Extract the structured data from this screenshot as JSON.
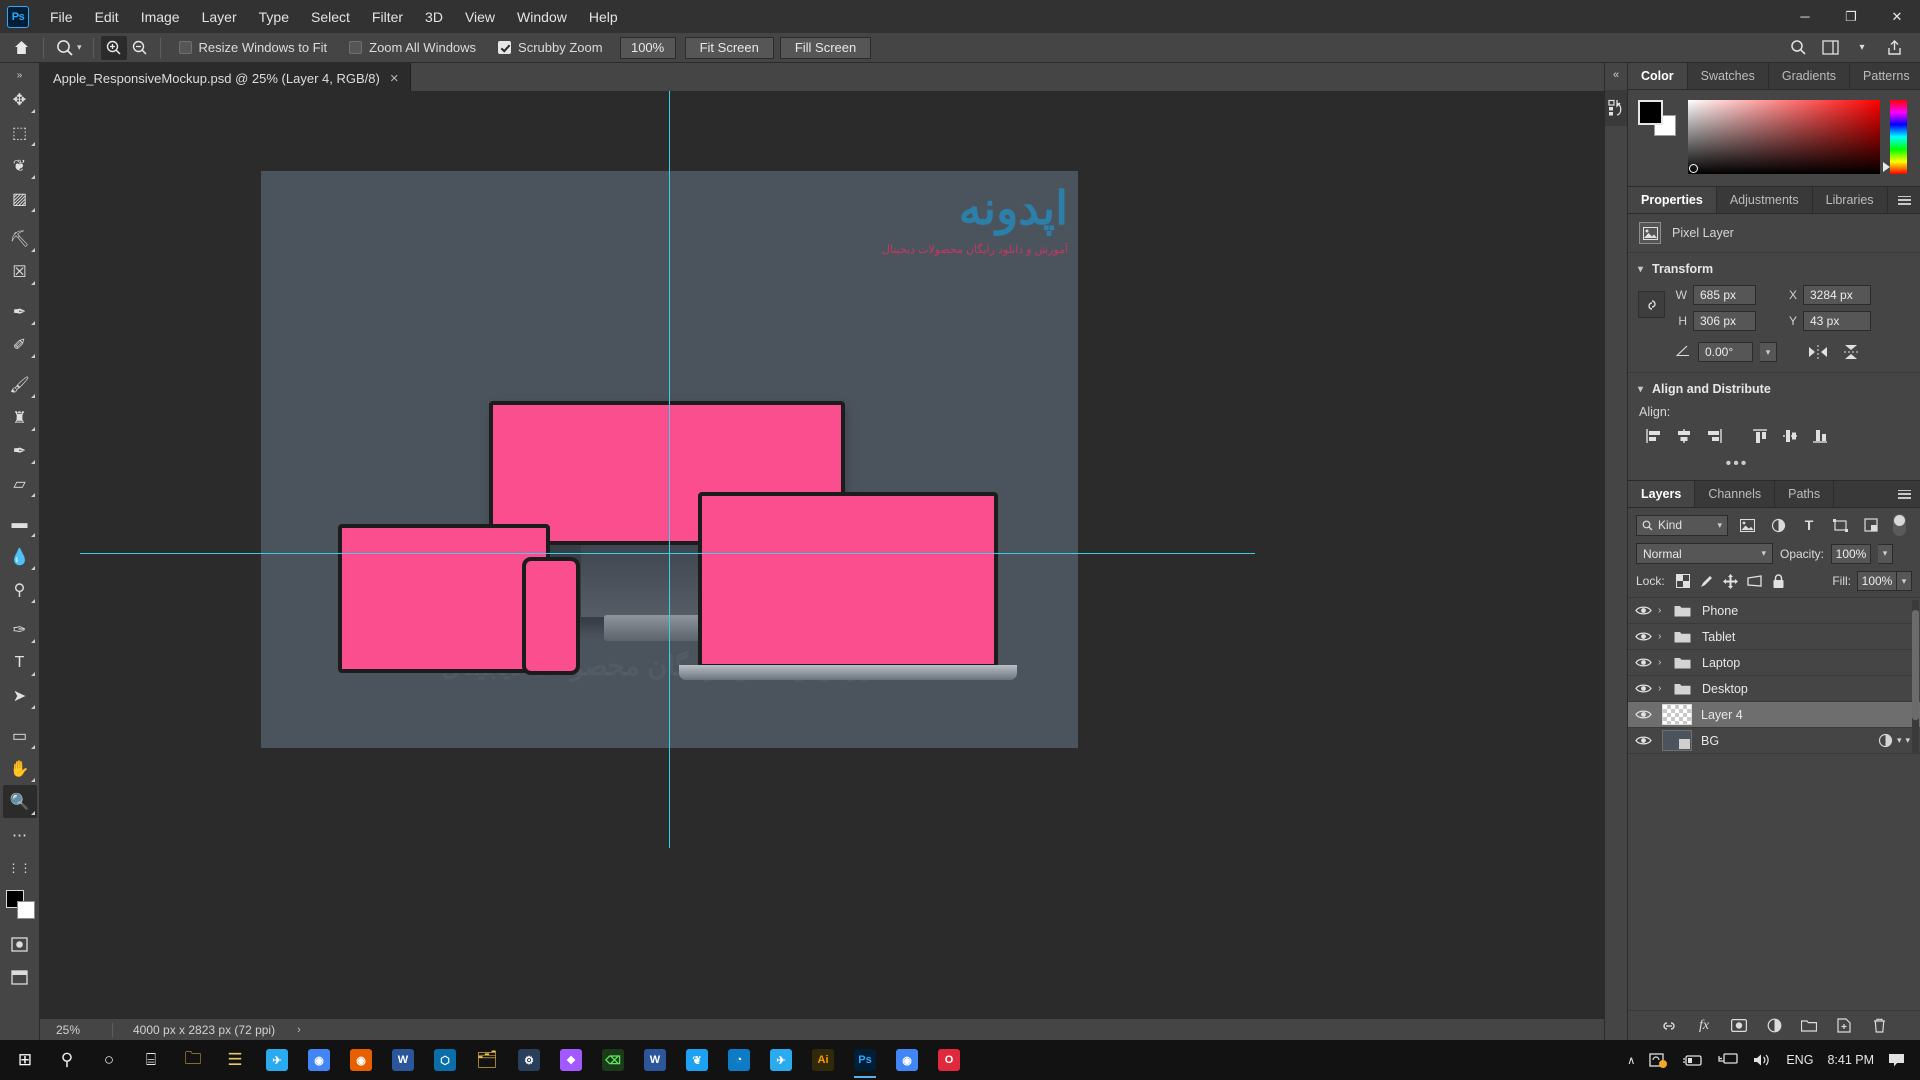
{
  "app": {
    "name": "Adobe Photoshop",
    "logo_text": "Ps"
  },
  "menubar": {
    "items": [
      "File",
      "Edit",
      "Image",
      "Layer",
      "Type",
      "Select",
      "Filter",
      "3D",
      "View",
      "Window",
      "Help"
    ]
  },
  "window_controls": {
    "minimize": "─",
    "maximize": "❐",
    "close": "✕"
  },
  "options_bar": {
    "home_icon": "home-icon",
    "tool_icon": "zoom-tool-icon",
    "zoom_in_label": "zoom-in-icon",
    "zoom_out_label": "zoom-out-icon",
    "checkboxes": [
      {
        "label": "Resize Windows to Fit",
        "checked": false
      },
      {
        "label": "Zoom All Windows",
        "checked": false
      },
      {
        "label": "Scrubby Zoom",
        "checked": true
      }
    ],
    "zoom_value": "100%",
    "buttons": [
      "Fit Screen",
      "Fill Screen"
    ],
    "right_icons": [
      "search-icon",
      "workspace-icon",
      "chevron-down-icon",
      "share-icon"
    ]
  },
  "toolbar": {
    "tools": [
      {
        "name": "move-tool",
        "glyph": "✥"
      },
      {
        "name": "rectangular-marquee-tool",
        "glyph": "⬚"
      },
      {
        "name": "lasso-tool",
        "glyph": "❦"
      },
      {
        "name": "object-selection-tool",
        "glyph": "▨"
      },
      {
        "name": "crop-tool",
        "glyph": "⛏"
      },
      {
        "name": "frame-tool",
        "glyph": "☒"
      },
      {
        "name": "eyedropper-tool",
        "glyph": "✒"
      },
      {
        "name": "spot-healing-brush-tool",
        "glyph": "✐"
      },
      {
        "name": "brush-tool",
        "glyph": "🖌"
      },
      {
        "name": "clone-stamp-tool",
        "glyph": "♜"
      },
      {
        "name": "history-brush-tool",
        "glyph": "✒"
      },
      {
        "name": "eraser-tool",
        "glyph": "▱"
      },
      {
        "name": "gradient-tool",
        "glyph": "▬"
      },
      {
        "name": "blur-tool",
        "glyph": "💧"
      },
      {
        "name": "dodge-tool",
        "glyph": "⚲"
      },
      {
        "name": "pen-tool",
        "glyph": "✑"
      },
      {
        "name": "type-tool",
        "glyph": "T"
      },
      {
        "name": "path-selection-tool",
        "glyph": "➤"
      },
      {
        "name": "rectangle-tool",
        "glyph": "▭"
      },
      {
        "name": "hand-tool",
        "glyph": "✋"
      },
      {
        "name": "zoom-tool",
        "glyph": "🔍",
        "active": true
      }
    ],
    "extra": [
      {
        "name": "more-tools-button",
        "glyph": "⋯"
      },
      {
        "name": "edit-toolbar-button",
        "glyph": "⋮⋮"
      },
      {
        "name": "quick-mask-button",
        "glyph": "▣"
      },
      {
        "name": "screen-mode-button",
        "glyph": "❐"
      }
    ],
    "foreground_color": "#000000",
    "background_color": "#ffffff"
  },
  "document": {
    "tab_title": "Apple_ResponsiveMockup.psd @ 25% (Layer 4, RGB/8)",
    "close_glyph": "×",
    "watermark_main": "اپدونه",
    "watermark_sub": "آموزش و دانلود رایگان محصولات دیجیتال",
    "watermark_faint": "آموزش و دانلود رایگان محصولات دیجیتال",
    "artboard_bg": "#4b535d",
    "device_screen_color": "#fb4e8f",
    "guide_color": "#35d1e8"
  },
  "status_bar": {
    "zoom": "25%",
    "doc_info": "4000 px x 2823 px (72 ppi)",
    "arrow": "›"
  },
  "rail": {
    "collapse_glyph": "«",
    "icon_name": "history-icon"
  },
  "color_panel": {
    "tabs": [
      "Color",
      "Swatches",
      "Gradients",
      "Patterns"
    ],
    "selected_tab": "Color",
    "foreground": "#000000",
    "background": "#ffffff",
    "menu_icon": "panel-menu-icon"
  },
  "properties_panel": {
    "tabs": [
      "Properties",
      "Adjustments",
      "Libraries"
    ],
    "selected_tab": "Properties",
    "layer_type": "Pixel Layer",
    "sections": {
      "transform": {
        "title": "Transform",
        "fields": [
          {
            "label": "W",
            "value": "685 px"
          },
          {
            "label": "X",
            "value": "3284 px"
          },
          {
            "label": "H",
            "value": "306 px"
          },
          {
            "label": "Y",
            "value": "43 px"
          }
        ],
        "angle_label": "angle-icon",
        "angle_value": "0.00°",
        "flip_horizontal": "flip-horizontal-icon",
        "flip_vertical": "flip-vertical-icon"
      },
      "align": {
        "title": "Align and Distribute",
        "label": "Align:",
        "buttons": [
          "align-left-edges-icon",
          "align-horizontal-centers-icon",
          "align-right-edges-icon",
          "align-top-edges-icon",
          "align-vertical-centers-icon",
          "align-bottom-edges-icon"
        ],
        "more": "•••"
      }
    }
  },
  "layers_panel": {
    "tabs": [
      "Layers",
      "Channels",
      "Paths"
    ],
    "selected_tab": "Layers",
    "filter": {
      "kind_label": "Kind",
      "search_icon": "search-icon",
      "type_icons": [
        "pixel-filter-icon",
        "adjustment-filter-icon",
        "type-filter-icon",
        "shape-filter-icon",
        "smartobject-filter-icon"
      ],
      "toggle_name": "filter-toggle"
    },
    "blend_mode": "Normal",
    "opacity_label": "Opacity:",
    "opacity_value": "100%",
    "lock_label": "Lock:",
    "lock_icons": [
      "lock-transparent-pixels-icon",
      "lock-image-pixels-icon",
      "lock-position-icon",
      "lock-artboard-icon",
      "lock-all-icon"
    ],
    "fill_label": "Fill:",
    "fill_value": "100%",
    "layers": [
      {
        "name": "Phone",
        "type": "group",
        "visible": true,
        "selected": false
      },
      {
        "name": "Tablet",
        "type": "group",
        "visible": true,
        "selected": false
      },
      {
        "name": "Laptop",
        "type": "group",
        "visible": true,
        "selected": false
      },
      {
        "name": "Desktop",
        "type": "group",
        "visible": true,
        "selected": false
      },
      {
        "name": "Layer 4",
        "type": "pixel-transparent",
        "visible": true,
        "selected": true
      },
      {
        "name": "BG",
        "type": "background",
        "visible": true,
        "selected": false,
        "has_fx": true
      }
    ],
    "footer_buttons": [
      "link-layers-icon",
      "layer-style-icon",
      "layer-mask-icon",
      "adjustment-layer-icon",
      "new-group-icon",
      "new-layer-icon",
      "delete-layer-icon"
    ]
  },
  "taskbar": {
    "apps": [
      {
        "name": "start-button",
        "glyph": "⊞",
        "color": "#ffffff",
        "bg": ""
      },
      {
        "name": "search-icon",
        "glyph": "⚲",
        "color": "#e8e8e8",
        "bg": ""
      },
      {
        "name": "cortana-icon",
        "glyph": "○",
        "color": "#e8e8e8",
        "bg": ""
      },
      {
        "name": "task-view-icon",
        "glyph": "⌸",
        "color": "#e8e8e8",
        "bg": ""
      },
      {
        "name": "file-explorer-icon",
        "glyph": "🗀",
        "color": "#f5c451",
        "bg": ""
      },
      {
        "name": "notepad-icon",
        "glyph": "☰",
        "color": "#e8c86a",
        "bg": ""
      },
      {
        "name": "telegram-alt-icon",
        "glyph": "✈",
        "color": "#ffffff",
        "bg": "#2aabee"
      },
      {
        "name": "chrome-icon",
        "glyph": "◉",
        "color": "#ffffff",
        "bg": "#4285f4"
      },
      {
        "name": "firefox-icon",
        "glyph": "◉",
        "color": "#ffffff",
        "bg": "#e66000"
      },
      {
        "name": "word-icon",
        "glyph": "W",
        "color": "#ffffff",
        "bg": "#2b579a"
      },
      {
        "name": "vscode-icon",
        "glyph": "⬡",
        "color": "#ffffff",
        "bg": "#0a6ea8"
      },
      {
        "name": "explorer2-icon",
        "glyph": "🗂",
        "color": "#f5c451",
        "bg": ""
      },
      {
        "name": "steam-icon",
        "glyph": "⚙",
        "color": "#ffffff",
        "bg": "#2a3f5a"
      },
      {
        "name": "figma-icon",
        "glyph": "❖",
        "color": "#ffffff",
        "bg": "#a259ff"
      },
      {
        "name": "terminal-icon",
        "glyph": "⌫",
        "color": "#5be85b",
        "bg": "#1b3b1b"
      },
      {
        "name": "word2-icon",
        "glyph": "W",
        "color": "#ffffff",
        "bg": "#2b579a"
      },
      {
        "name": "twitter-icon",
        "glyph": "❦",
        "color": "#ffffff",
        "bg": "#1da1f2"
      },
      {
        "name": "edge-icon",
        "glyph": "◔",
        "color": "#ffffff",
        "bg": "#0d7cc4"
      },
      {
        "name": "telegram-icon",
        "glyph": "✈",
        "color": "#ffffff",
        "bg": "#2aabee"
      },
      {
        "name": "illustrator-icon",
        "glyph": "Ai",
        "color": "#ff9a00",
        "bg": "#30290a"
      },
      {
        "name": "photoshop-icon",
        "glyph": "Ps",
        "color": "#31a8ff",
        "bg": "#001e36",
        "running": true
      },
      {
        "name": "chrome2-icon",
        "glyph": "◉",
        "color": "#ffffff",
        "bg": "#4285f4"
      },
      {
        "name": "opera-icon",
        "glyph": "O",
        "color": "#ffffff",
        "bg": "#e0293c"
      }
    ],
    "tray": {
      "chevron": "∧",
      "icons": [
        "onedrive-icon",
        "battery-icon",
        "network-icon",
        "volume-icon"
      ],
      "language": "ENG",
      "time": "8:41 PM",
      "notifications": "notification-icon"
    }
  }
}
